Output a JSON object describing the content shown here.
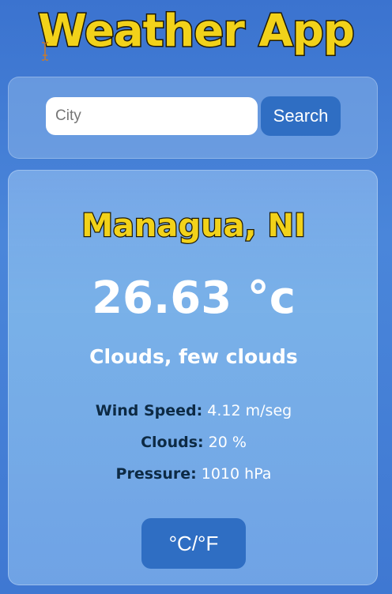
{
  "header": {
    "title": "Weather App"
  },
  "search": {
    "placeholder": "City",
    "value": "",
    "button_label": "Search"
  },
  "weather": {
    "city": "Managua, NI",
    "temperature": "26.63 °c",
    "description": "Clouds, few clouds",
    "details": [
      {
        "label": "Wind Speed:",
        "value": " 4.12 m/seg"
      },
      {
        "label": "Clouds:",
        "value": " 20 %"
      },
      {
        "label": "Pressure:",
        "value": " 1010 hPa"
      }
    ],
    "unit_toggle_label": "°C/°F"
  },
  "colors": {
    "background": "#4a86da",
    "title_yellow": "#f2d21a",
    "button_blue": "#2f6ec3",
    "label_dark": "#0d2a44"
  },
  "icons": {
    "cursor": "text-cursor-icon"
  }
}
